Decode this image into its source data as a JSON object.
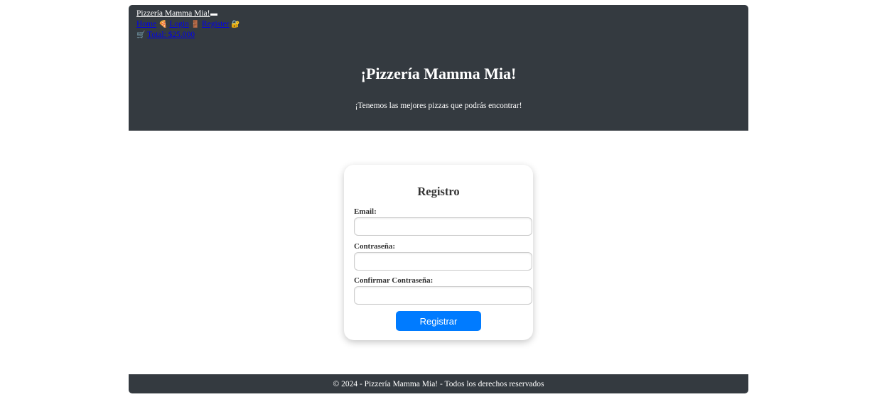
{
  "nav": {
    "brand": "Pizzería Mamma Mia!",
    "links": [
      {
        "label": "Home",
        "icon": "🍕"
      },
      {
        "label": "Login",
        "icon": "🚪"
      },
      {
        "label": "Register",
        "icon": "🔐"
      }
    ],
    "cart_icon": "🛒",
    "cart_label": "Total: $25.000"
  },
  "hero": {
    "title": "¡Pizzería Mamma Mia!",
    "subtitle": "¡Tenemos las mejores pizzas que podrás encontrar!"
  },
  "form": {
    "title": "Registro",
    "email_label": "Email:",
    "email_value": "",
    "password_label": "Contraseña:",
    "password_value": "",
    "confirm_label": "Confirmar Contraseña:",
    "confirm_value": "",
    "submit_label": "Registrar"
  },
  "footer": {
    "text": "© 2024 - Pizzería Mamma Mia! - Todos los derechos reservados"
  },
  "colors": {
    "header_bg": "#343a40",
    "button_bg": "#007bff"
  }
}
